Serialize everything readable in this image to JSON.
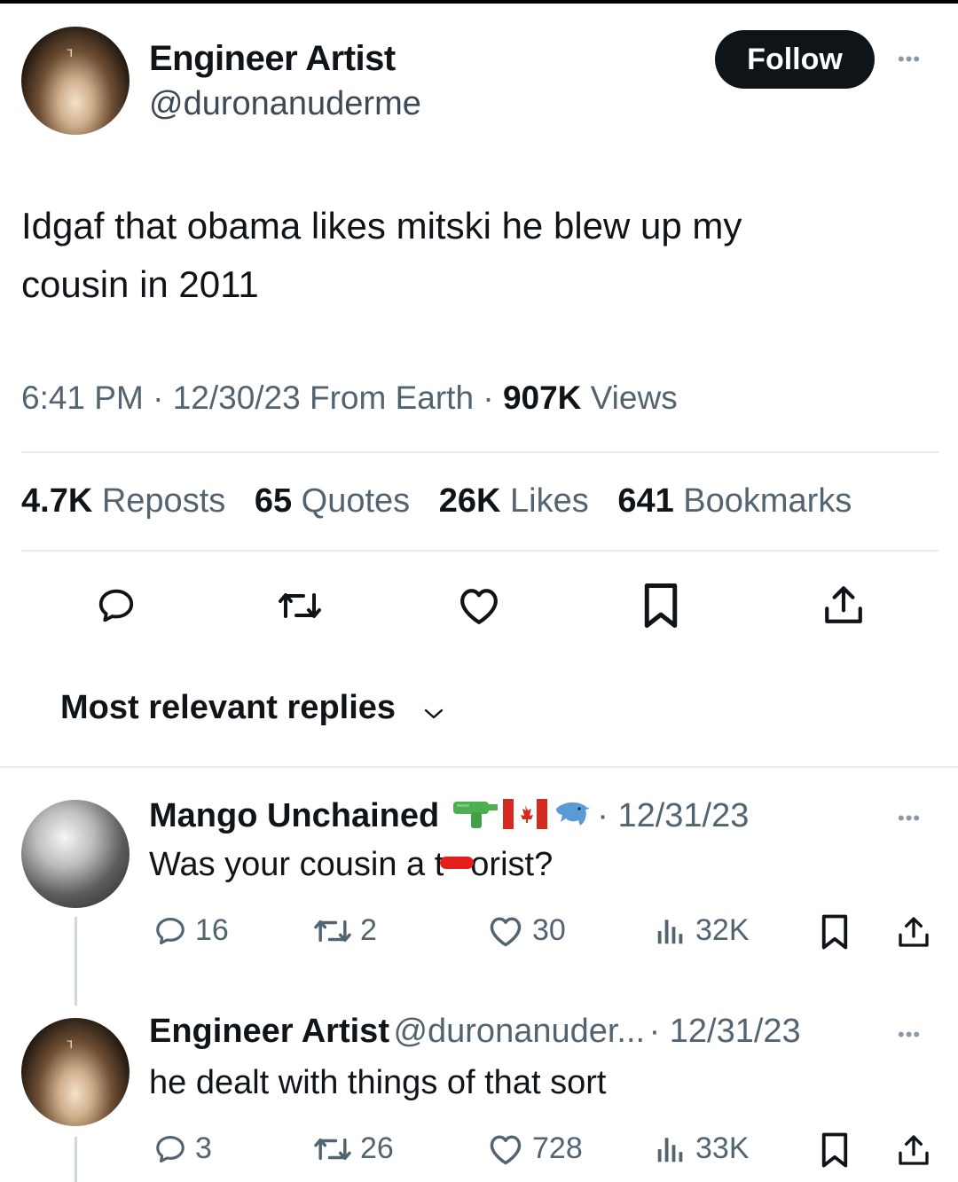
{
  "tweet": {
    "author_name": "Engineer Artist",
    "author_handle": "@duronanuderme",
    "follow_label": "Follow",
    "text_line1": "Idgaf that obama likes mitski he blew up my",
    "text_line2": "cousin in 2011",
    "time": "6:41 PM",
    "date": "12/30/23",
    "source": "From Earth",
    "views_count": "907K",
    "views_label": "Views",
    "stats": {
      "reposts_count": "4.7K",
      "reposts_label": "Reposts",
      "quotes_count": "65",
      "quotes_label": "Quotes",
      "likes_count": "26K",
      "likes_label": "Likes",
      "bookmarks_count": "641",
      "bookmarks_label": "Bookmarks"
    }
  },
  "replies_header": {
    "label": "Most relevant replies"
  },
  "replies": [
    {
      "name": "Mango Unchained",
      "emojis": [
        "water-pistol-icon",
        "canada-flag-icon",
        "dolphin-icon"
      ],
      "date": "· 12/31/23",
      "text_before": "Was your cousin a t",
      "text_after": "orist?",
      "comments": "16",
      "reposts": "2",
      "likes": "30",
      "views": "32K"
    },
    {
      "name": "Engineer Artist",
      "handle": "@duronanuder...",
      "date": "· 12/31/23",
      "text": "he dealt with things of that sort",
      "comments": "3",
      "reposts": "26",
      "likes": "728",
      "views": "33K"
    }
  ],
  "colors": {
    "text_primary": "#0f1419",
    "text_secondary": "#536471",
    "follow_bg": "#0f1419",
    "divider": "#e6ecf0",
    "redaction": "#e41d1d"
  }
}
